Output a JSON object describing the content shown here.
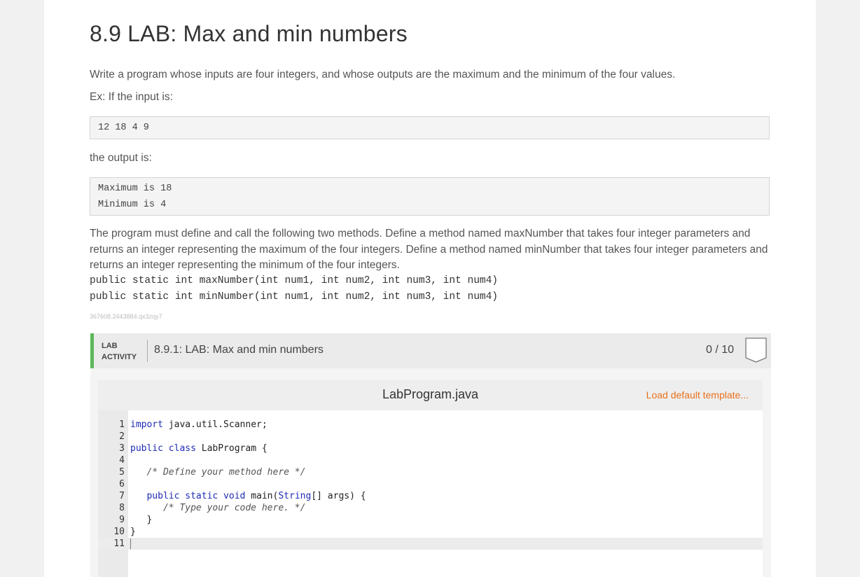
{
  "title": "8.9 LAB: Max and min numbers",
  "intro": "Write a program whose inputs are four integers, and whose outputs are the maximum and the minimum of the four values.",
  "example_label": "Ex: If the input is:",
  "example_input": "12 18 4 9",
  "output_label": "the output is:",
  "example_output": [
    "Maximum is 18",
    "Minimum is 4"
  ],
  "description": "The program must define and call the following two methods. Define a method named maxNumber that takes four integer parameters and returns an integer representing the maximum of the four integers. Define a method named minNumber that takes four integer parameters and returns an integer representing the minimum of the four integers.",
  "signatures": [
    "public static int maxNumber(int num1, int num2, int num3, int num4)",
    "public static int minNumber(int num1, int num2, int num3, int num4)"
  ],
  "activity_id": "367608.2443884.qx3zqy7",
  "lab": {
    "tag_line1": "LAB",
    "tag_line2": "ACTIVITY",
    "title": "8.9.1: LAB: Max and min numbers",
    "score": "0 / 10",
    "accent_color": "#5cb85c"
  },
  "editor": {
    "filename": "LabProgram.java",
    "load_template": "Load default template...",
    "line_numbers": [
      "1",
      "2",
      "3",
      "4",
      "5",
      "6",
      "7",
      "8",
      "9",
      "10",
      "11"
    ],
    "lines": [
      [
        {
          "t": "import",
          "c": "kw"
        },
        {
          "t": " java.util.Scanner;",
          "c": ""
        }
      ],
      [],
      [
        {
          "t": "public class",
          "c": "kw"
        },
        {
          "t": " LabProgram {",
          "c": ""
        }
      ],
      [],
      [
        {
          "t": "   /* Define your method here */",
          "c": "cm"
        }
      ],
      [],
      [
        {
          "t": "   ",
          "c": ""
        },
        {
          "t": "public static void",
          "c": "kw"
        },
        {
          "t": " main(",
          "c": ""
        },
        {
          "t": "String",
          "c": "kw"
        },
        {
          "t": "[] args) {",
          "c": ""
        }
      ],
      [
        {
          "t": "      /* Type your code here. */",
          "c": "cm"
        }
      ],
      [
        {
          "t": "   }",
          "c": ""
        }
      ],
      [
        {
          "t": "}",
          "c": ""
        }
      ],
      []
    ],
    "keyword_color": "#1e2bb3"
  }
}
